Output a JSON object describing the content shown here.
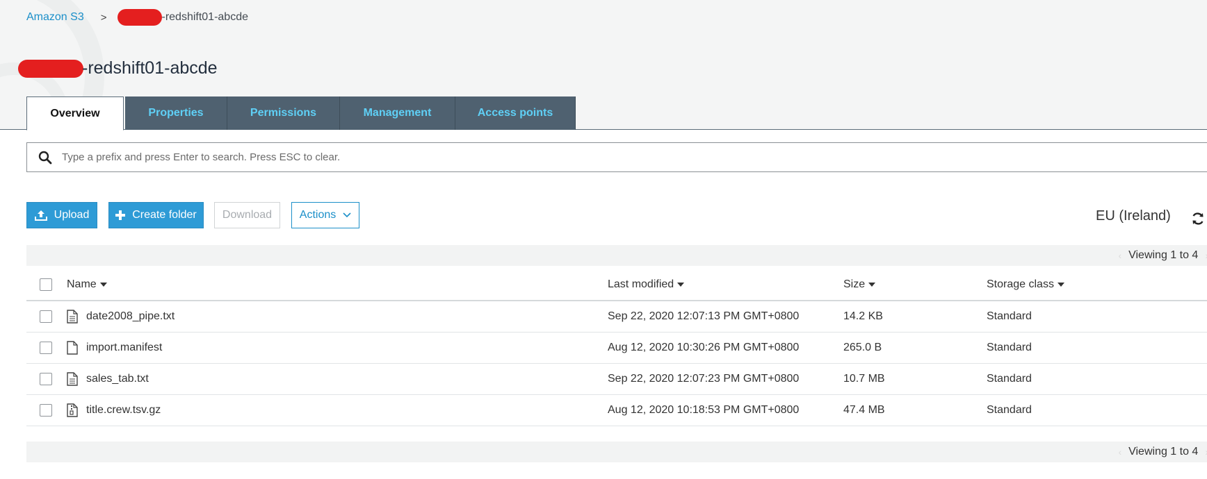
{
  "breadcrumb": {
    "root": "Amazon S3",
    "separator": ">",
    "current": "-redshift01-abcde"
  },
  "page_title": "-redshift01-abcde",
  "tabs": [
    {
      "label": "Overview",
      "active": true
    },
    {
      "label": "Properties",
      "active": false
    },
    {
      "label": "Permissions",
      "active": false
    },
    {
      "label": "Management",
      "active": false
    },
    {
      "label": "Access points",
      "active": false
    }
  ],
  "search": {
    "placeholder": "Type a prefix and press Enter to search. Press ESC to clear.",
    "value": ""
  },
  "toolbar": {
    "upload_label": "Upload",
    "create_folder_label": "Create folder",
    "download_label": "Download",
    "actions_label": "Actions"
  },
  "region": "EU (Ireland)",
  "viewing_text": "Viewing 1 to 4",
  "table": {
    "headers": {
      "name": "Name",
      "last_modified": "Last modified",
      "size": "Size",
      "storage_class": "Storage class"
    },
    "rows": [
      {
        "name": "date2008_pipe.txt",
        "modified": "Sep 22, 2020 12:07:13 PM GMT+0800",
        "size": "14.2 KB",
        "storage_class": "Standard",
        "icon": "text-file-icon"
      },
      {
        "name": "import.manifest",
        "modified": "Aug 12, 2020 10:30:26 PM GMT+0800",
        "size": "265.0 B",
        "storage_class": "Standard",
        "icon": "blank-file-icon"
      },
      {
        "name": "sales_tab.txt",
        "modified": "Sep 22, 2020 12:07:23 PM GMT+0800",
        "size": "10.7 MB",
        "storage_class": "Standard",
        "icon": "text-file-icon"
      },
      {
        "name": "title.crew.tsv.gz",
        "modified": "Aug 12, 2020 10:18:53 PM GMT+0800",
        "size": "47.4 MB",
        "storage_class": "Standard",
        "icon": "archive-file-icon"
      }
    ]
  },
  "colors": {
    "link": "#1b8fc9",
    "primary_button": "#2e9bd6",
    "tab_bg": "#4f6170",
    "tab_text": "#5fd0f6",
    "redaction": "#e41f1f"
  }
}
